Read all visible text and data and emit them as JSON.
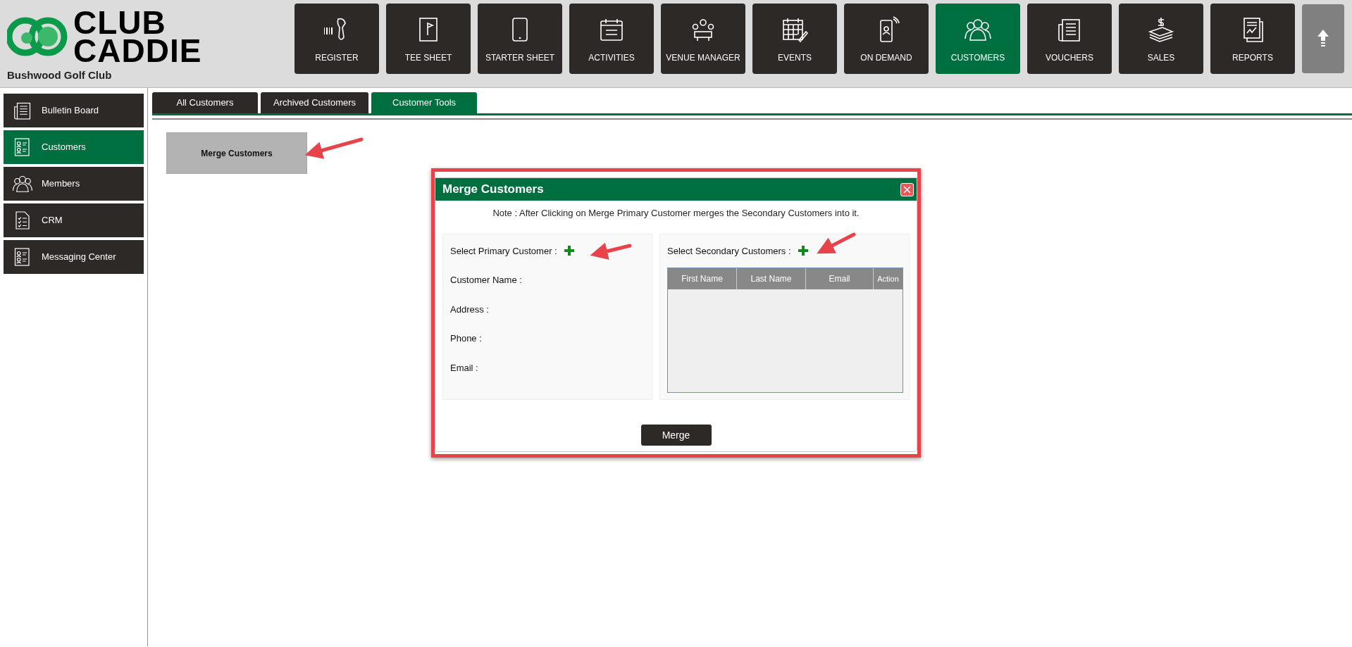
{
  "brand": {
    "logo_line_1": "CLUB",
    "logo_line_2": "CADDIE",
    "club_name": "Bushwood Golf Club"
  },
  "nav": [
    {
      "label": "REGISTER",
      "selected": false
    },
    {
      "label": "TEE SHEET",
      "selected": false
    },
    {
      "label": "STARTER SHEET",
      "selected": false
    },
    {
      "label": "ACTIVITIES",
      "selected": false
    },
    {
      "label": "VENUE MANAGER",
      "selected": false
    },
    {
      "label": "EVENTS",
      "selected": false
    },
    {
      "label": "ON DEMAND",
      "selected": false
    },
    {
      "label": "CUSTOMERS",
      "selected": true
    },
    {
      "label": "VOUCHERS",
      "selected": false
    },
    {
      "label": "SALES",
      "selected": false
    },
    {
      "label": "REPORTS",
      "selected": false
    }
  ],
  "sidebar": {
    "items": [
      {
        "label": "Bulletin Board",
        "selected": false
      },
      {
        "label": "Customers",
        "selected": true
      },
      {
        "label": "Members",
        "selected": false
      },
      {
        "label": "CRM",
        "selected": false
      },
      {
        "label": "Messaging Center",
        "selected": false
      }
    ]
  },
  "tabs": [
    {
      "label": "All Customers",
      "selected": false
    },
    {
      "label": "Archived Customers",
      "selected": false
    },
    {
      "label": "Customer Tools",
      "selected": true
    }
  ],
  "tool_button": "Merge Customers",
  "modal": {
    "title": "Merge Customers",
    "note": "Note : After Clicking on Merge Primary Customer merges the Secondary Customers into it.",
    "primary": {
      "label": "Select Primary Customer :",
      "fields": [
        "Customer Name :",
        "Address :",
        "Phone :",
        "Email :"
      ]
    },
    "secondary": {
      "label": "Select Secondary Customers :",
      "columns": [
        "First Name",
        "Last Name",
        "Email",
        "Action"
      ]
    },
    "merge_button": "Merge"
  }
}
